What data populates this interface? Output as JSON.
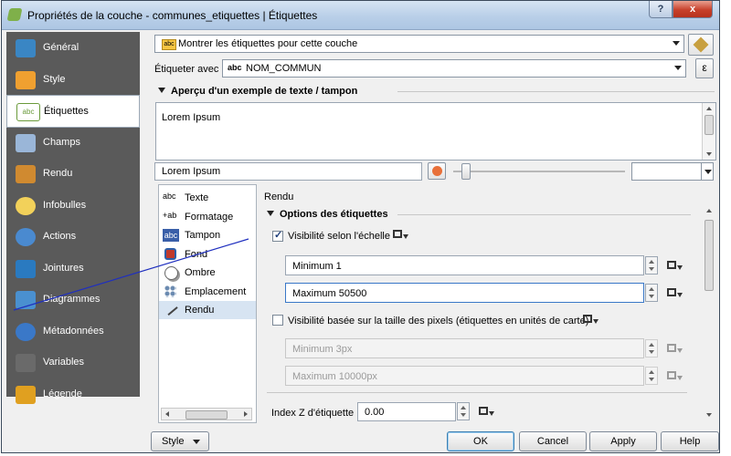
{
  "window": {
    "title": "Propriétés de la couche - communes_etiquettes | Étiquettes",
    "help_button": "?",
    "close_button": "x"
  },
  "sidebar": {
    "items": [
      {
        "label": "Général",
        "icon": "wrench-icon",
        "color": "#3a86c4"
      },
      {
        "label": "Style",
        "icon": "paint-icon",
        "color": "#f0a030"
      },
      {
        "label": "Étiquettes",
        "icon": "label-icon",
        "color": "#6a9a3a"
      },
      {
        "label": "Champs",
        "icon": "table-icon",
        "color": "#9ab6d8"
      },
      {
        "label": "Rendu",
        "icon": "brush-icon",
        "color": "#d08a30"
      },
      {
        "label": "Infobulles",
        "icon": "tooltip-icon",
        "color": "#f2d15a"
      },
      {
        "label": "Actions",
        "icon": "gear-icon",
        "color": "#4a8ad0"
      },
      {
        "label": "Jointures",
        "icon": "join-icon",
        "color": "#2a7ac0"
      },
      {
        "label": "Diagrammes",
        "icon": "diagram-icon",
        "color": "#4a90d0"
      },
      {
        "label": "Métadonnées",
        "icon": "info-icon",
        "color": "#3a78c8"
      },
      {
        "label": "Variables",
        "icon": "variables-icon",
        "color": "#6a6a6a"
      },
      {
        "label": "Légende",
        "icon": "legend-icon",
        "color": "#e0a020"
      }
    ],
    "active_index": 2
  },
  "labels_mode": {
    "selected": "Montrer les étiquettes pour cette couche"
  },
  "label_with": {
    "label": "Étiqueter avec",
    "prefix": "abc",
    "field": "NOM_COMMUN",
    "expression_button": "ε"
  },
  "preview_section": {
    "title": "Aperçu d'un exemple de texte / tampon",
    "text": "Lorem Ipsum",
    "sample_input": "Lorem Ipsum"
  },
  "categories": {
    "items": [
      {
        "label": "Texte",
        "icon": "text-icon",
        "glyph": "abc"
      },
      {
        "label": "Formatage",
        "icon": "formatting-icon",
        "glyph": "+ab"
      },
      {
        "label": "Tampon",
        "icon": "buffer-icon",
        "glyph": "abc"
      },
      {
        "label": "Fond",
        "icon": "background-icon",
        "glyph": ""
      },
      {
        "label": "Ombre",
        "icon": "shadow-icon",
        "glyph": ""
      },
      {
        "label": "Emplacement",
        "icon": "placement-icon",
        "glyph": ""
      },
      {
        "label": "Rendu",
        "icon": "rendering-icon",
        "glyph": ""
      }
    ],
    "selected_index": 6
  },
  "rendering": {
    "heading": "Rendu",
    "options_title": "Options des étiquettes",
    "scale_visibility": {
      "label": "Visibilité selon l'échelle",
      "checked": true
    },
    "minimum": "Minimum 1",
    "maximum": "Maximum 50500",
    "pixel_visibility": {
      "label": "Visibilité basée sur la taille des pixels (étiquettes en unités de carte)",
      "checked": false
    },
    "minimum_px": "Minimum 3px",
    "maximum_px": "Maximum 10000px",
    "zindex_label": "Index Z d'étiquette",
    "zindex_value": "0.00"
  },
  "footer": {
    "style_button": "Style",
    "ok": "OK",
    "cancel": "Cancel",
    "apply": "Apply",
    "help": "Help"
  },
  "colors": {
    "sidebar_bg": "#5a5a5a",
    "accent": "#1f4fbf",
    "annotation_line": "#1f2fbf"
  }
}
